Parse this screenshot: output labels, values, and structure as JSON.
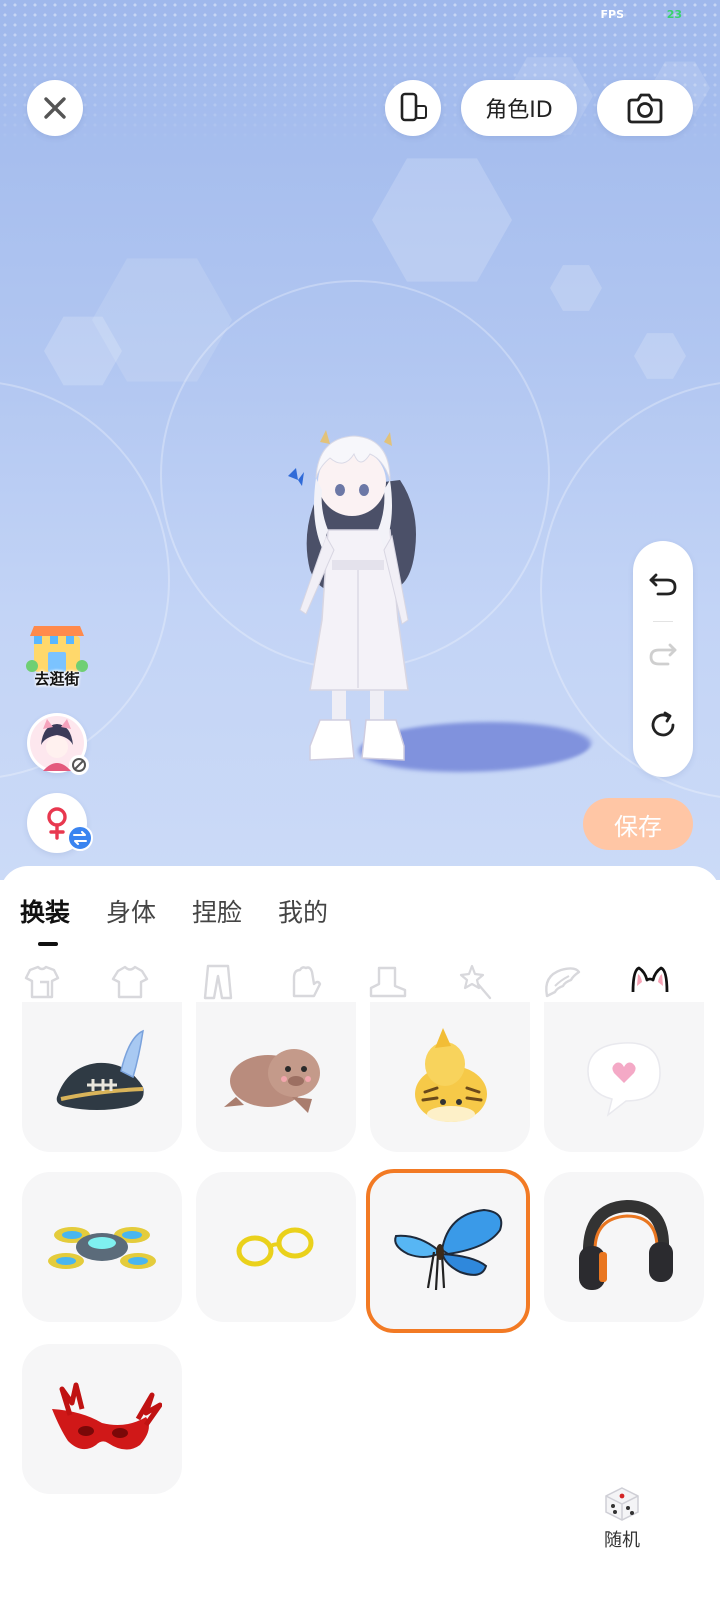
{
  "status": {
    "fps_label": "FPS",
    "fps_value": "23"
  },
  "toolbar": {
    "close_icon": "close-icon",
    "device_icon": "device-switch-icon",
    "role_id_label": "角色ID",
    "camera_icon": "camera-icon"
  },
  "side": {
    "shop_label": "去逛街",
    "avatar_icon": "avatar-icon",
    "gender_icon": "female-swap-icon"
  },
  "history": {
    "undo_icon": "undo-icon",
    "redo_icon": "redo-icon",
    "reset_icon": "reset-icon"
  },
  "save_label": "保存",
  "tabs": [
    {
      "label": "换装",
      "active": true
    },
    {
      "label": "身体",
      "active": false
    },
    {
      "label": "捏脸",
      "active": false
    },
    {
      "label": "我的",
      "active": false
    }
  ],
  "categories": [
    "outfit-icon",
    "top-icon",
    "pants-icon",
    "glove-icon",
    "shoe-icon",
    "magic-wand-icon",
    "wing-icon",
    "cat-ears-icon"
  ],
  "active_category": "cat-ears-icon",
  "items": [
    {
      "name": "pirate-hat",
      "selected": false
    },
    {
      "name": "seal-plush",
      "selected": false
    },
    {
      "name": "tiger-cat-plush",
      "selected": false
    },
    {
      "name": "heart-bubble",
      "selected": false
    },
    {
      "name": "drone",
      "selected": false
    },
    {
      "name": "yellow-glasses",
      "selected": false
    },
    {
      "name": "blue-butterfly",
      "selected": true
    },
    {
      "name": "headphones",
      "selected": false
    },
    {
      "name": "red-antler-mask",
      "selected": false
    }
  ],
  "colors": {
    "accent": "#f27a24",
    "save_bg": "#ffc6a5",
    "gender": "#e8384f",
    "swap": "#3a84f0"
  },
  "random_label": "随机"
}
